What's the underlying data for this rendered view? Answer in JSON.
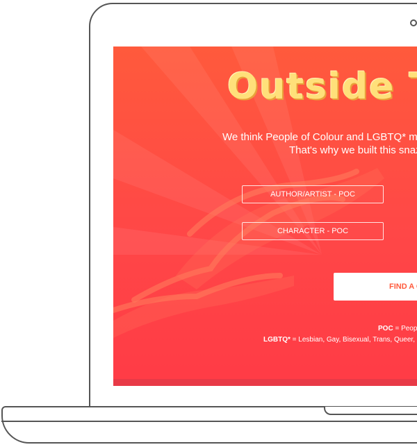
{
  "site": {
    "title": "Outside T",
    "tagline_line1": "We think People of Colour and LGBTQ* make",
    "tagline_line2": "That's why we built this snazz"
  },
  "filters": [
    {
      "label": "AUTHOR/ARTIST - POC"
    },
    {
      "label": "CHARACTER - POC"
    }
  ],
  "find_button": {
    "label": "FIND A C"
  },
  "legend": {
    "poc_term": "POC",
    "poc_definition": " = Peopl",
    "lgbtq_term": "LGBTQ*",
    "lgbtq_definition": " = Lesbian, Gay, Bisexual, Trans, Queer, Q"
  },
  "colors": {
    "background_top": "#ff5a3c",
    "background_bottom": "#ff3b46",
    "title": "#ffe07a",
    "button_text": "#ff5a3c"
  }
}
